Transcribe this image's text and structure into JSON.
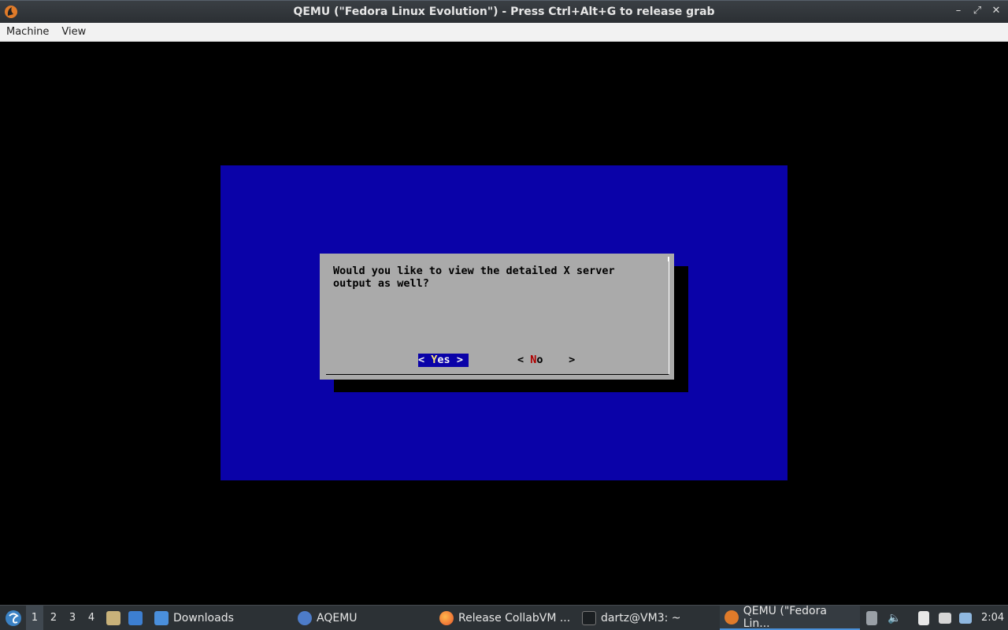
{
  "window": {
    "title": "QEMU (\"Fedora Linux Evolution\") - Press Ctrl+Alt+G to release grab",
    "controls": [
      "–",
      "⤢",
      "✕"
    ]
  },
  "menubar": {
    "items": [
      "Machine",
      "View"
    ]
  },
  "guest": {
    "dialog": {
      "message": "Would you like to view the detailed X server\noutput as well?",
      "yes": {
        "left": "<",
        "hot": "Y",
        "rest": "es",
        "right": ">"
      },
      "no": {
        "left": "<",
        "hot": "N",
        "rest": "o",
        "right": ">"
      }
    },
    "colors": {
      "background": "#000000",
      "screen_blue": "#0a02a8",
      "dialog_gray": "#aaaaaa"
    }
  },
  "taskbar": {
    "workspaces": [
      "1",
      "2",
      "3",
      "4"
    ],
    "active_workspace": "1",
    "tasks": {
      "downloads": "Downloads",
      "aqemu": "AQEMU",
      "firefox": "Release CollabVM ...",
      "terminal": "dartz@VM3: ~",
      "qemu": "QEMU (\"Fedora Lin..."
    },
    "clock": "2:04"
  }
}
